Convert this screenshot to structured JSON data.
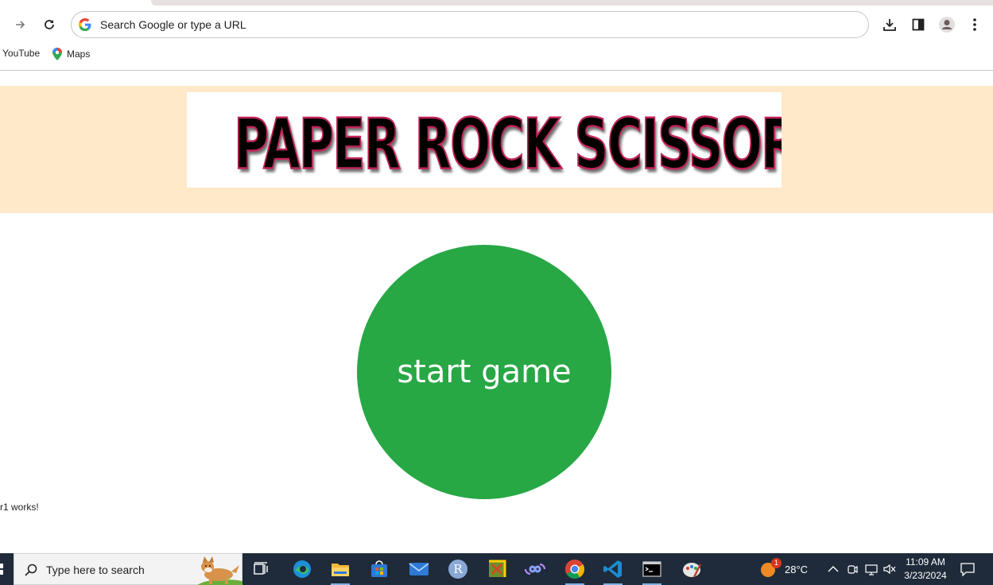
{
  "browser": {
    "omnibox_placeholder": "Search Google or type a URL",
    "bookmarks": [
      {
        "label": "YouTube"
      },
      {
        "label": "Maps"
      }
    ]
  },
  "page": {
    "title_banner": "PAPER ROCK SCISSOR",
    "start_button_label": "start game",
    "status_text": "r1 works!"
  },
  "taskbar": {
    "search_placeholder": "Type here to search",
    "weather_temp": "28°C",
    "weather_badge": "1",
    "time": "11:09 AM",
    "date": "3/23/2024"
  },
  "colors": {
    "banner_bg": "#ffe9c8",
    "start_button": "#28a745",
    "taskbar_bg": "#1f2b3a"
  }
}
